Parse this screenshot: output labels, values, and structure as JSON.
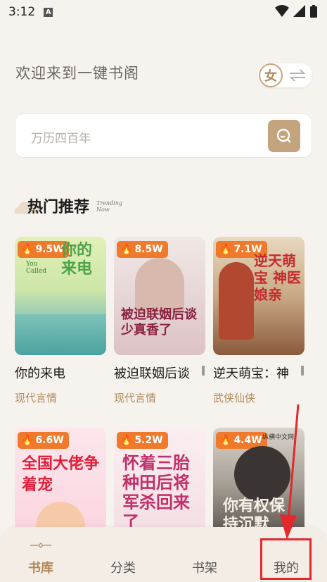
{
  "status_bar": {
    "time": "3:12",
    "app_indicator": "A",
    "icons": [
      "wifi-icon",
      "signal-icon",
      "battery-icon"
    ]
  },
  "header": {
    "welcome": "欢迎来到一键书阁",
    "gender_label": "女",
    "swap_icon": "swap-arrows-icon"
  },
  "search": {
    "placeholder": "万历四百年",
    "button_icon": "search-icon"
  },
  "section": {
    "title": "热门推荐",
    "subtitle_line1": "Trending",
    "subtitle_line2": "Now"
  },
  "books": [
    {
      "heat": "9.5W",
      "title": "你的来电",
      "genre": "现代言情",
      "cover_text": "你的来电",
      "cover_sub": "You Called"
    },
    {
      "heat": "8.5W",
      "title": "被迫联姻后谈",
      "genre": "现代言情",
      "cover_text": "被迫联姻后谈少真香了",
      "cover_sub": ""
    },
    {
      "heat": "7.1W",
      "title": "逆天萌宝：神",
      "genre": "武侠仙侠",
      "cover_text": "逆天萌宝 神医娘亲",
      "cover_sub": ""
    },
    {
      "heat": "6.6W",
      "title": "",
      "genre": "",
      "cover_text": "全国大佬争着宠",
      "cover_sub": ""
    },
    {
      "heat": "5.2W",
      "title": "",
      "genre": "",
      "cover_text": "怀着三胎种田后将军杀回来了",
      "cover_sub": ""
    },
    {
      "heat": "4.4W",
      "title": "",
      "genre": "",
      "cover_text": "你有权保持沉默",
      "cover_sub": "纵横中文网"
    }
  ],
  "nav": {
    "items": [
      "书库",
      "分类",
      "书架",
      "我的"
    ],
    "active_index": 0
  },
  "colors": {
    "accent": "#c4a47d",
    "heat_badge": "#f07a2c",
    "genre": "#b08a5a",
    "annotation": "#e3282e"
  }
}
